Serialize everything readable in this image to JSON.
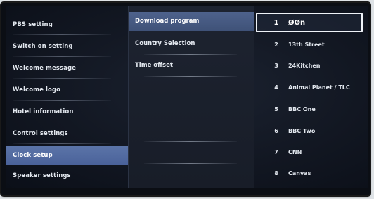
{
  "main_menu": {
    "items": [
      {
        "label": "PBS setting"
      },
      {
        "label": "Switch on setting"
      },
      {
        "label": "Welcome message"
      },
      {
        "label": "Welcome logo"
      },
      {
        "label": "Hotel information"
      },
      {
        "label": "Control settings"
      },
      {
        "label": "Clock setup"
      },
      {
        "label": "Speaker settings"
      }
    ],
    "selected_index": 6
  },
  "sub_menu": {
    "items": [
      {
        "label": "Download program"
      },
      {
        "label": "Country Selection"
      },
      {
        "label": "Time offset"
      }
    ],
    "selected_index": 0
  },
  "channel_list": {
    "items": [
      {
        "number": "1",
        "name": "ØØn"
      },
      {
        "number": "2",
        "name": "13th Street"
      },
      {
        "number": "3",
        "name": "24Kitchen"
      },
      {
        "number": "4",
        "name": "Animal Planet / TLC"
      },
      {
        "number": "5",
        "name": "BBC One"
      },
      {
        "number": "6",
        "name": "BBC Two"
      },
      {
        "number": "7",
        "name": "CNN"
      },
      {
        "number": "8",
        "name": "Canvas"
      }
    ],
    "selected_index": 0
  },
  "colors": {
    "background": "#121722",
    "main_selected": "#5b74a8",
    "sub_selected": "#4e628c",
    "focus_border": "#eef2f7"
  }
}
